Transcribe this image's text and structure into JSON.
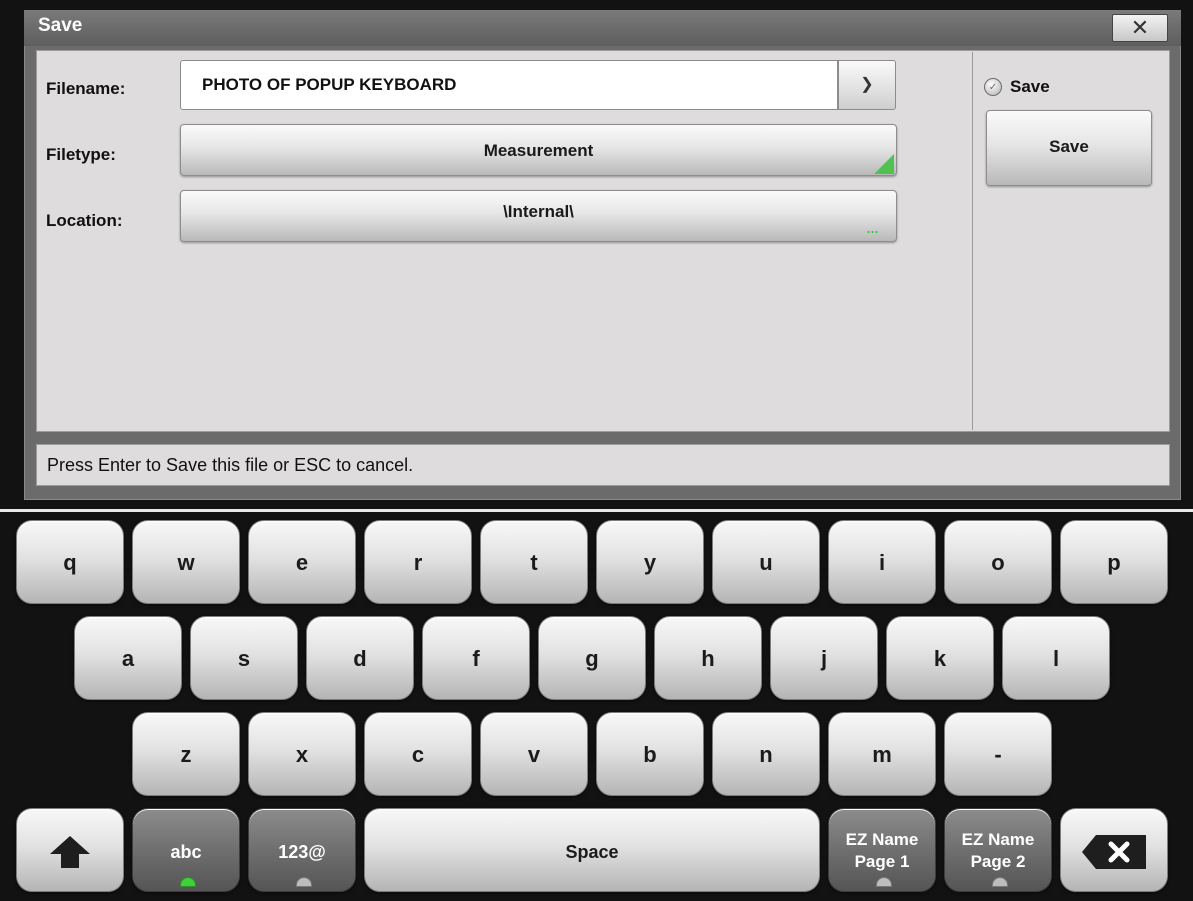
{
  "dialog": {
    "title": "Save",
    "close_icon": "x-icon"
  },
  "form": {
    "filename_label": "Filename:",
    "filename_value": "PHOTO OF POPUP KEYBOARD",
    "filename_dropdown_icon": "chevron-down-icon",
    "filetype_label": "Filetype:",
    "filetype_value": "Measurement",
    "location_label": "Location:",
    "location_value": "\\Internal\\",
    "location_more": "..."
  },
  "side": {
    "radio_label": "Save",
    "button_label": "Save"
  },
  "status_text": "Press Enter to Save this file or ESC to cancel.",
  "keyboard": {
    "row1": [
      "q",
      "w",
      "e",
      "r",
      "t",
      "y",
      "u",
      "i",
      "o",
      "p"
    ],
    "row2": [
      "a",
      "s",
      "d",
      "f",
      "g",
      "h",
      "j",
      "k",
      "l"
    ],
    "row3": [
      "z",
      "x",
      "c",
      "v",
      "b",
      "n",
      "m",
      "-"
    ],
    "shift_icon": "shift-arrow-icon",
    "abc_label": "abc",
    "num_label": "123@",
    "space_label": "Space",
    "ez1_line1": "EZ Name",
    "ez1_line2": "Page 1",
    "ez2_line1": "EZ Name",
    "ez2_line2": "Page 2",
    "backspace_icon": "backspace-icon"
  },
  "colors": {
    "indicator_active": "#3ed13a",
    "filetype_marker": "#4fc24f"
  }
}
